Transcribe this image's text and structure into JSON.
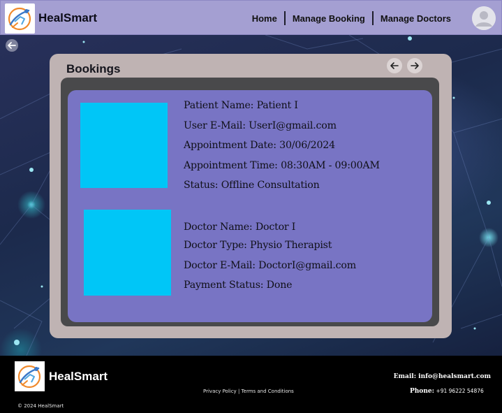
{
  "app": {
    "name": "HealSmart"
  },
  "header": {
    "brand": "HealSmart",
    "nav": [
      {
        "label": "Home"
      },
      {
        "label": "Manage Booking"
      },
      {
        "label": "Manage Doctors"
      }
    ]
  },
  "bookings": {
    "title": "Bookings",
    "patient_fields": [
      {
        "label": "Patient Name:",
        "value": "Patient I"
      },
      {
        "label": "User E-Mail:",
        "value": "UserI@gmail.com"
      },
      {
        "label": "Appointment Date:",
        "value": "30/06/2024"
      },
      {
        "label": "Appointment Time:",
        "value": "08:30AM - 09:00AM"
      },
      {
        "label": "Status:",
        "value": "Offline Consultation"
      }
    ],
    "doctor_fields": [
      {
        "label": "Doctor Name:",
        "value": "Doctor I"
      },
      {
        "label": "Doctor Type:",
        "value": "Physio Therapist"
      },
      {
        "label": "Doctor E-Mail:",
        "value": "DoctorI@gmail.com"
      },
      {
        "label": "Payment Status:",
        "value": "Done"
      }
    ],
    "placeholder_color": "#00c6f7"
  },
  "footer": {
    "brand": "HealSmart",
    "privacy": "Privacy Policy",
    "divider": "|",
    "terms": "Terms and Conditions",
    "email_label": "Email:",
    "email_value": "info@healsmart.com",
    "phone_label": "Phone:",
    "phone_value": "+91 96222 54876",
    "copyright": "© 2024 HealSmart"
  },
  "icons": {
    "logo": "physio-figure-logo-icon",
    "avatar": "user-avatar-icon",
    "back": "arrow-left-circle-icon",
    "prev": "arrow-left-icon",
    "next": "arrow-right-icon"
  },
  "colors": {
    "header_bg": "#a49fd2",
    "card_bg": "#bfb3b3",
    "frame_bg": "#49494b",
    "panel_bg": "#7874c4",
    "footer_bg": "#000000"
  }
}
